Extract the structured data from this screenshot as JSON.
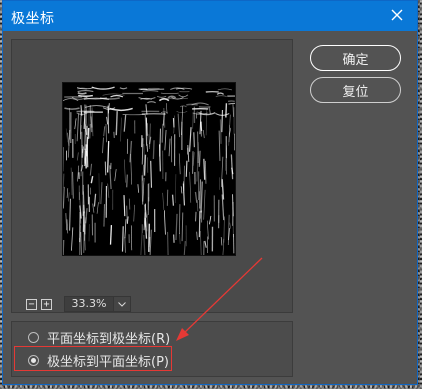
{
  "window": {
    "title": "极坐标"
  },
  "buttons": {
    "ok_label": "确定",
    "reset_label": "复位"
  },
  "preview": {
    "zoom_value": "33.3%"
  },
  "options": {
    "rect_to_polar": "平面坐标到极坐标(R)",
    "polar_to_rect": "极坐标到平面坐标(P)",
    "selected": "polar_to_rect"
  },
  "colors": {
    "titlebar": "#0a78d7",
    "annotation": "#e53935"
  }
}
